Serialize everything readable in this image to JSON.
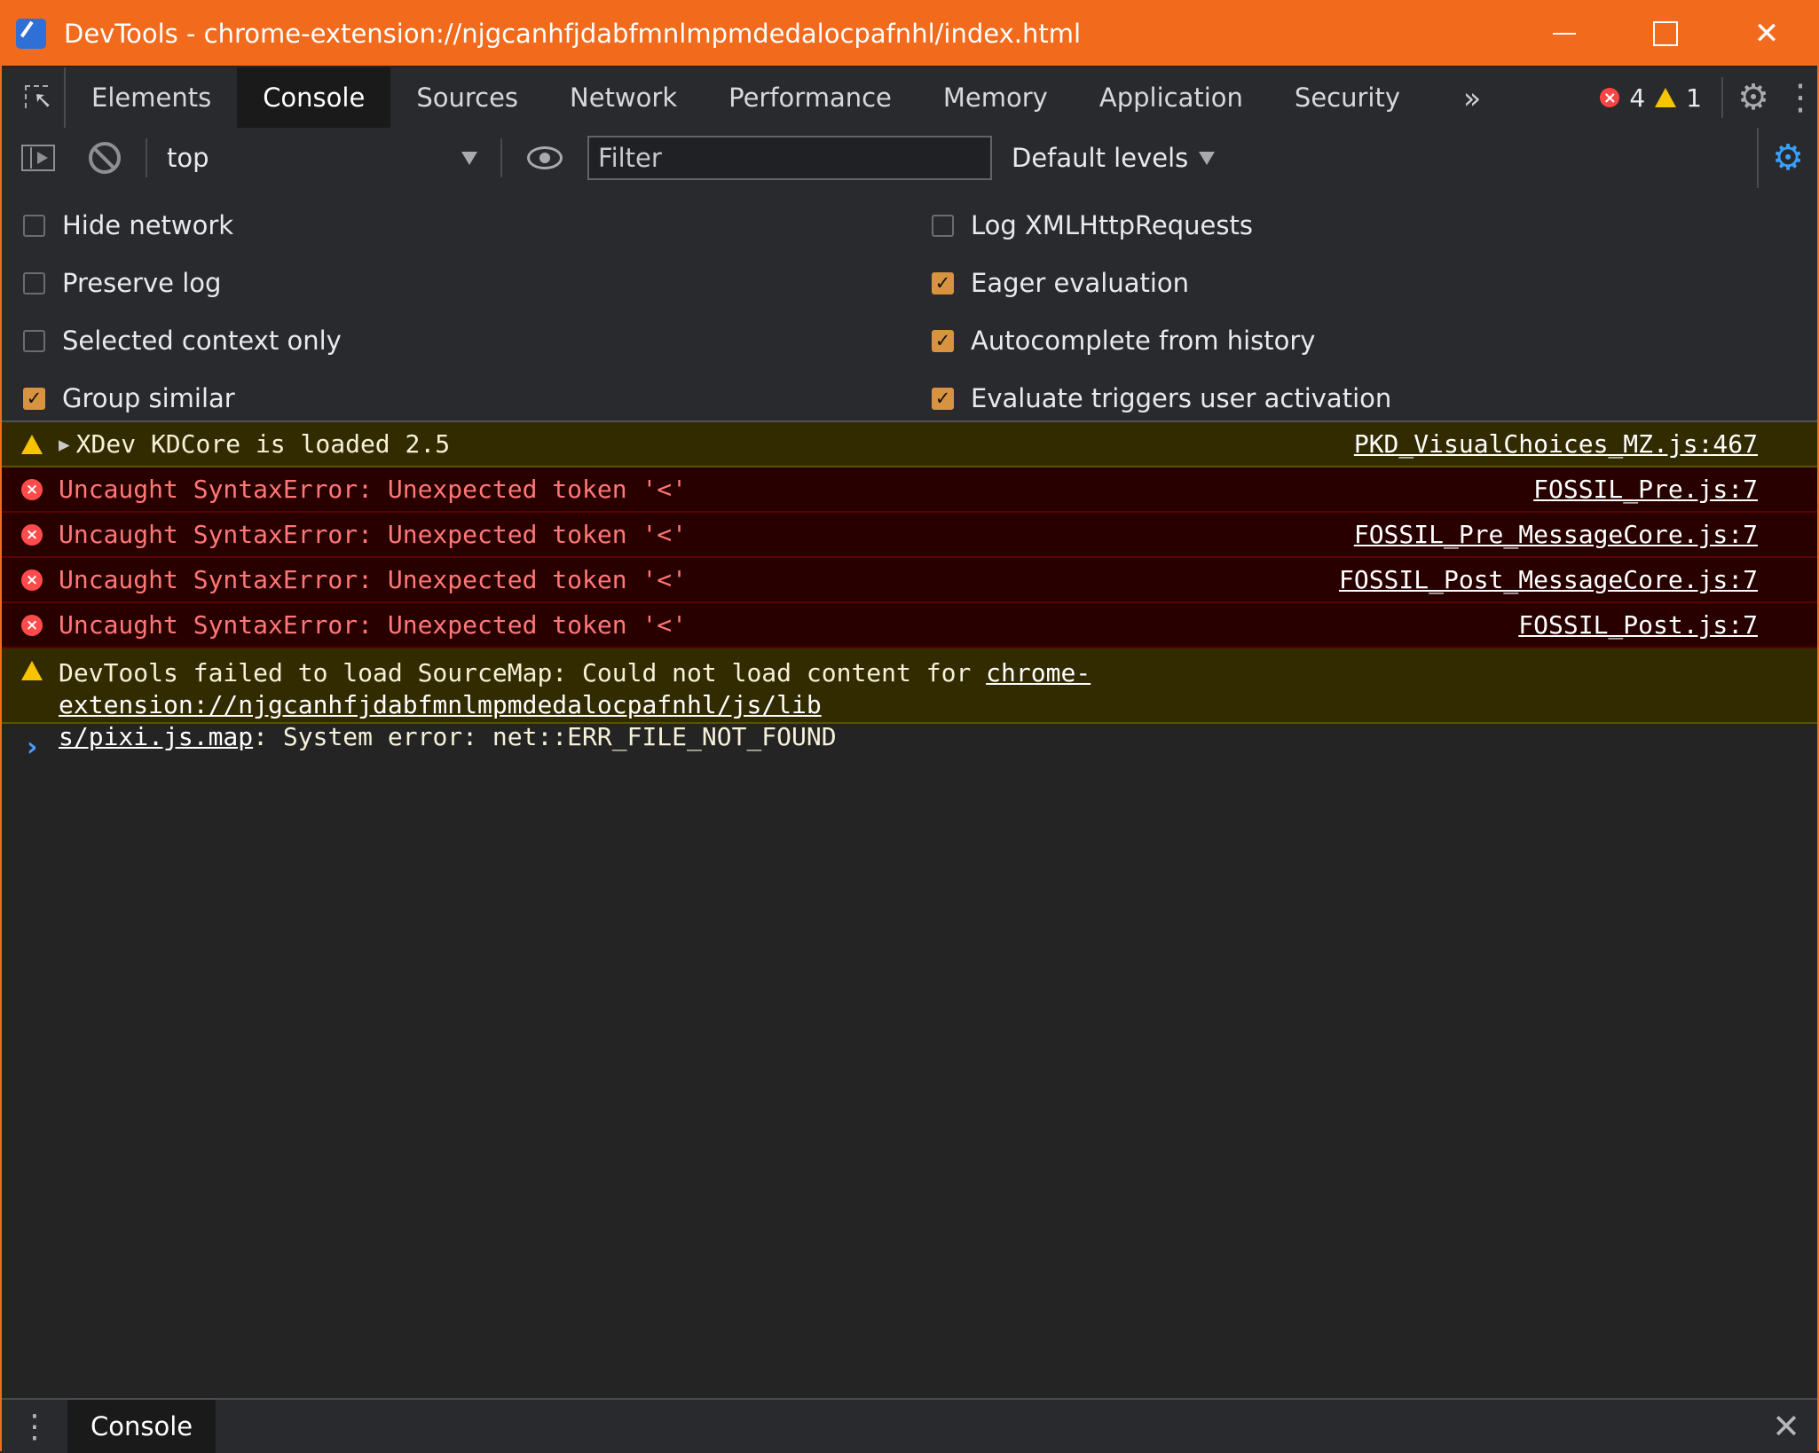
{
  "window": {
    "title": "DevTools - chrome-extension://njgcanhfjdabfmnlmpmdedalocpafnhl/index.html",
    "minimize_symbol": "—",
    "close_symbol": "✕"
  },
  "tabs": [
    {
      "label": "Elements"
    },
    {
      "label": "Console"
    },
    {
      "label": "Sources"
    },
    {
      "label": "Network"
    },
    {
      "label": "Performance"
    },
    {
      "label": "Memory"
    },
    {
      "label": "Application"
    },
    {
      "label": "Security"
    }
  ],
  "toolbar": {
    "more_tabs": "»",
    "error_count": "4",
    "warning_count": "1",
    "error_symbol": "×",
    "gear_symbol": "⚙",
    "kebab_symbol": "⋮"
  },
  "console_toolbar": {
    "context": "top",
    "filter_placeholder": "Filter",
    "levels": "Default levels",
    "settings_symbol": "⚙"
  },
  "settings": {
    "left": [
      {
        "label": "Hide network",
        "checked": false
      },
      {
        "label": "Preserve log",
        "checked": false
      },
      {
        "label": "Selected context only",
        "checked": false
      },
      {
        "label": "Group similar",
        "checked": true
      }
    ],
    "right": [
      {
        "label": "Log XMLHttpRequests",
        "checked": false
      },
      {
        "label": "Eager evaluation",
        "checked": true
      },
      {
        "label": "Autocomplete from history",
        "checked": true
      },
      {
        "label": "Evaluate triggers user activation",
        "checked": true
      }
    ],
    "check_symbol": "✓"
  },
  "messages": [
    {
      "level": "warning",
      "text": "XDev KDCore is loaded 2.5",
      "source": "PKD_VisualChoices_MZ.js:467",
      "expand": "▶"
    },
    {
      "level": "error",
      "text": "Uncaught SyntaxError: Unexpected token '<'",
      "source": "FOSSIL_Pre.js:7"
    },
    {
      "level": "error",
      "text": "Uncaught SyntaxError: Unexpected token '<'",
      "source": "FOSSIL_Pre_MessageCore.js:7"
    },
    {
      "level": "error",
      "text": "Uncaught SyntaxError: Unexpected token '<'",
      "source": "FOSSIL_Post_MessageCore.js:7"
    },
    {
      "level": "error",
      "text": "Uncaught SyntaxError: Unexpected token '<'",
      "source": "FOSSIL_Post.js:7"
    }
  ],
  "sourcemap_warning": {
    "prefix": "DevTools failed to load SourceMap: Could not load content for ",
    "url_line1": "chrome-extension://njgcanhfjdabfmnlmpmdedalocpafnhl/js/lib",
    "url_line2": "s/pixi.js.map",
    "suffix": ": System error: net::ERR_FILE_NOT_FOUND"
  },
  "prompt": {
    "caret": "›"
  },
  "drawer": {
    "menu_symbol": "⋮",
    "tab": "Console",
    "close_symbol": "✕"
  },
  "colors": {
    "title_bar": "#f26b1d",
    "warning_background": "#332b00",
    "error_background": "#290000",
    "checkbox_checked": "#d7933f",
    "settings_active": "#39a0ff"
  }
}
